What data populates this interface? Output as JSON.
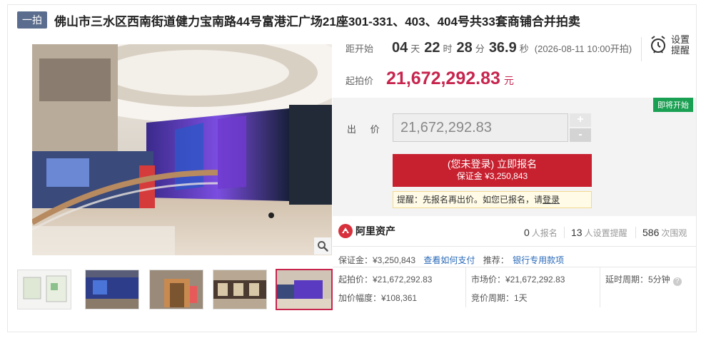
{
  "header": {
    "badge": "一拍",
    "title": "佛山市三水区西南街道健力宝南路44号富港汇广场21座301-331、403、404号共33套商铺合并拍卖"
  },
  "timer": {
    "label": "距开始",
    "days": "04",
    "days_unit": "天",
    "hours": "22",
    "hours_unit": "时",
    "minutes": "28",
    "minutes_unit": "分",
    "seconds": "36.9",
    "seconds_unit": "秒",
    "note": "(2026-08-11 10:00开拍)"
  },
  "reminder": {
    "line1": "设置",
    "line2": "提醒",
    "icon": "alarm-clock-icon"
  },
  "start_price": {
    "label": "起拍价",
    "value": "21,672,292.83",
    "unit": "元"
  },
  "bid": {
    "status_badge": "即将开始",
    "label": "出 价",
    "input_value": "21,672,292.83",
    "plus": "+",
    "minus": "-",
    "signup_line1": "(您未登录) 立即报名",
    "signup_line2": "保证金 ¥3,250,843",
    "tip_text": "提醒：先报名再出价。如您已报名，请",
    "tip_link": "登录"
  },
  "stats": {
    "brand": "阿里资产",
    "signups_count": "0",
    "signups_label": "人报名",
    "reminders_count": "13",
    "reminders_label": "人设置提醒",
    "views_count": "586",
    "views_label": "次围观"
  },
  "deposit": {
    "text": "保证金：¥3,250,843",
    "pay_link": "查看如何支付",
    "recommend_label": "推荐：",
    "bank_link": "银行专用款项"
  },
  "details": {
    "start_price": "起拍价：¥21,672,292.83",
    "market_price": "市场价：¥21,672,292.83",
    "delay_period": "延时周期：5分钟",
    "increment": "加价幅度：¥108,361",
    "auction_period": "竞价周期：1天"
  },
  "colors": {
    "accent": "#c7254e",
    "button": "#c7202f",
    "status_green": "#1aa052",
    "badge": "#5b6d8e",
    "link": "#2a6ab9"
  }
}
